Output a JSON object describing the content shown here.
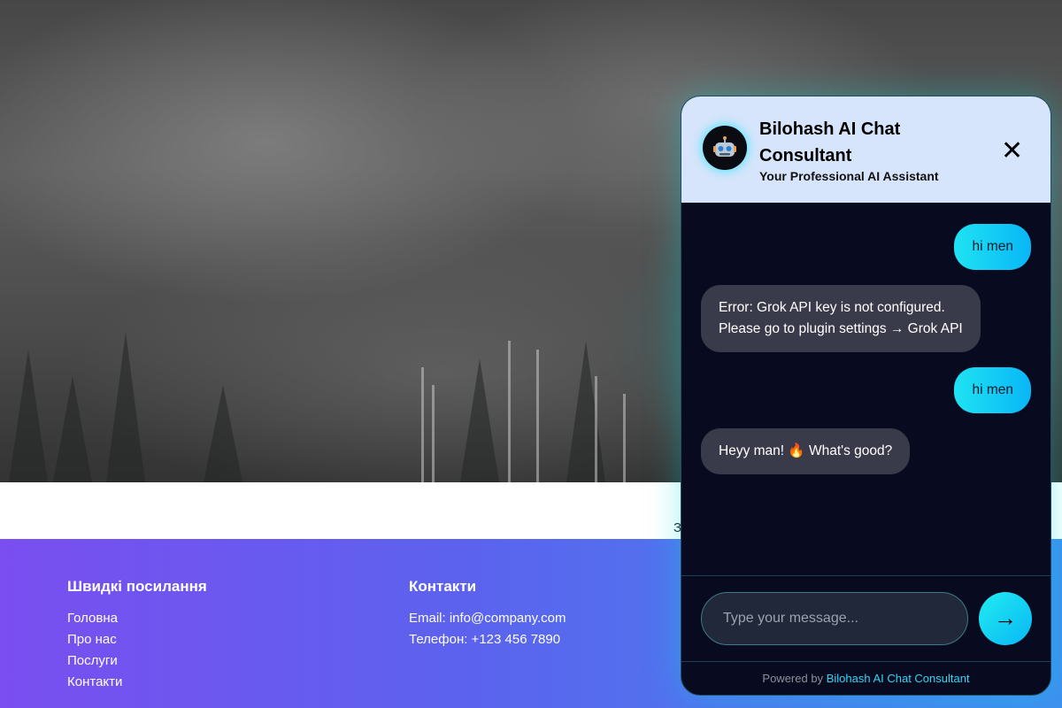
{
  "background": {
    "band_text": "З"
  },
  "footer": {
    "quick_links": {
      "title": "Швидкі посилання",
      "items": [
        "Головна",
        "Про нас",
        "Послуги",
        "Контакти"
      ]
    },
    "contacts": {
      "title": "Контакти",
      "email": "Email: info@company.com",
      "phone": "Телефон: +123 456 7890"
    }
  },
  "chat": {
    "title": "Bilohash AI Chat Consultant",
    "subtitle": "Your Professional AI Assistant",
    "avatar_icon": "robot-icon",
    "close_label": "✕",
    "messages": [
      {
        "role": "user",
        "text": "hi men"
      },
      {
        "role": "bot",
        "line1": "Error: Grok API key is not configured.",
        "line2": "Please go to plugin settings → Grok API"
      },
      {
        "role": "user",
        "text": "hi men"
      },
      {
        "role": "bot",
        "text": "Heyy man! 🔥 What's good?"
      }
    ],
    "input_placeholder": "Type your message...",
    "send_label": "→",
    "powered_prefix": "Powered by",
    "powered_link": "Bilohash AI Chat Consultant"
  },
  "colors": {
    "accent": "#1fe3f3",
    "header_bg": "#d6e5fb",
    "chat_bg": "#080a1f",
    "footer_gradient_start": "#7a4ef0",
    "footer_gradient_end": "#3e8ff0"
  }
}
